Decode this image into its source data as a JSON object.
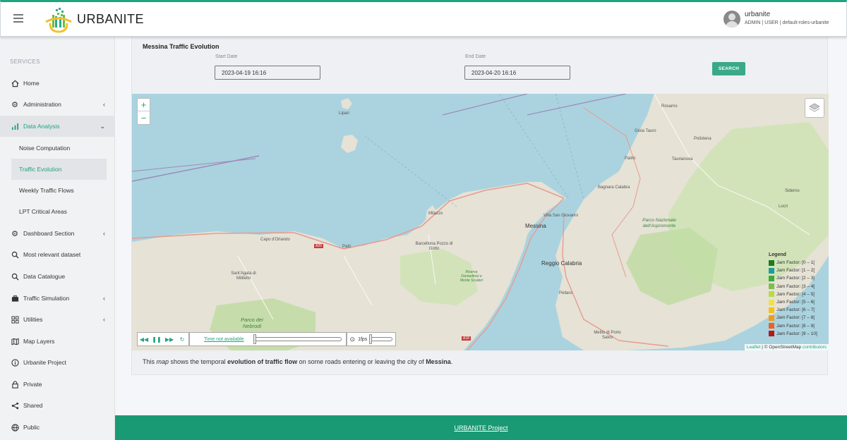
{
  "header": {
    "brand": "URBANITE",
    "user_name": "urbanite",
    "user_roles": "ADMIN | USER | default-roles-urbanite"
  },
  "sidebar": {
    "title": "SERVICES",
    "items": [
      {
        "label": "Home",
        "icon": "home-icon"
      },
      {
        "label": "Administration",
        "icon": "gear-icon",
        "chevron": "‹"
      },
      {
        "label": "Data Analysis",
        "icon": "bar-chart-icon",
        "chevron": "⌄"
      },
      {
        "label": "Dashboard Section",
        "icon": "gear-icon",
        "chevron": "‹"
      },
      {
        "label": "Most relevant dataset",
        "icon": "search-icon"
      },
      {
        "label": "Data Catalogue",
        "icon": "search-icon"
      },
      {
        "label": "Traffic Simulation",
        "icon": "briefcase-icon",
        "chevron": "‹"
      },
      {
        "label": "Utilities",
        "icon": "grid-icon",
        "chevron": "‹"
      },
      {
        "label": "Map Layers",
        "icon": "map-icon"
      },
      {
        "label": "Urbanite Project",
        "icon": "info-icon"
      },
      {
        "label": "Private",
        "icon": "lock-icon"
      },
      {
        "label": "Shared",
        "icon": "share-icon"
      },
      {
        "label": "Public",
        "icon": "globe-icon"
      }
    ],
    "sub_items": [
      "Noise Computation",
      "Traffic Evolution",
      "Weekly Traffic Flows",
      "LPT Critical Areas"
    ]
  },
  "main": {
    "title": "Messina Traffic Evolution",
    "start_label": "Start Date",
    "start_value": "2023-04-19 16:16",
    "end_label": "End Date",
    "end_value": "2023-04-20 16:16",
    "search_label": "SEARCH"
  },
  "map": {
    "zoom_in": "+",
    "zoom_out": "−",
    "places": [
      "Lipari",
      "Milazzo",
      "Capo d'Orlando",
      "Patti",
      "Barcellona Pozzo di Gotto",
      "Sant'Agata di Militello",
      "Messina",
      "Villa San Giovanni",
      "Reggio Calabria",
      "Bagnara Calabra",
      "Palmi",
      "Gioia Tauro",
      "Taurianova",
      "Polistena",
      "Rosarno",
      "Siderno",
      "Locri",
      "Pellaro",
      "Melito di Porto Salvo",
      "Parco dei Nebrodi",
      "Parco Nazionale dell'Aspromonte",
      "Riserva Fiumedinisi e Monte Scuderi",
      "A20",
      "A18"
    ],
    "legend": {
      "title": "Legend",
      "entries": [
        {
          "label": "Jam Factor: [0 – 1[",
          "color": "#1f7a1f"
        },
        {
          "label": "Jam Factor: [1 – 2[",
          "color": "#1e9c9c"
        },
        {
          "label": "Jam Factor: [2 – 3[",
          "color": "#3fa93f"
        },
        {
          "label": "Jam Factor: [3 – 4[",
          "color": "#7fbf4f"
        },
        {
          "label": "Jam Factor: [4 – 5[",
          "color": "#b8d94a"
        },
        {
          "label": "Jam Factor: [5 – 6[",
          "color": "#f0e14a"
        },
        {
          "label": "Jam Factor: [6 – 7[",
          "color": "#f5c21a"
        },
        {
          "label": "Jam Factor: [7 – 8[",
          "color": "#f29a1a"
        },
        {
          "label": "Jam Factor: [8 – 9[",
          "color": "#e8622a"
        },
        {
          "label": "Jam Factor: [9 – 10]",
          "color": "#b31b1b"
        }
      ]
    },
    "time_label": "Time not available",
    "fps_label": "1fps",
    "attribution_leaflet": "Leaflet",
    "attribution_text": "| © OpenStreetMap",
    "attribution_contrib": "contributors"
  },
  "caption": {
    "p1": "This ",
    "p2": "map",
    "p3": " shows the temporal ",
    "p4": "evolution of traffic flow",
    "p5": " on some roads entering or leaving the city of ",
    "p6": "Messina",
    "p7": "."
  },
  "footer": {
    "link": "URBANITE Project"
  }
}
